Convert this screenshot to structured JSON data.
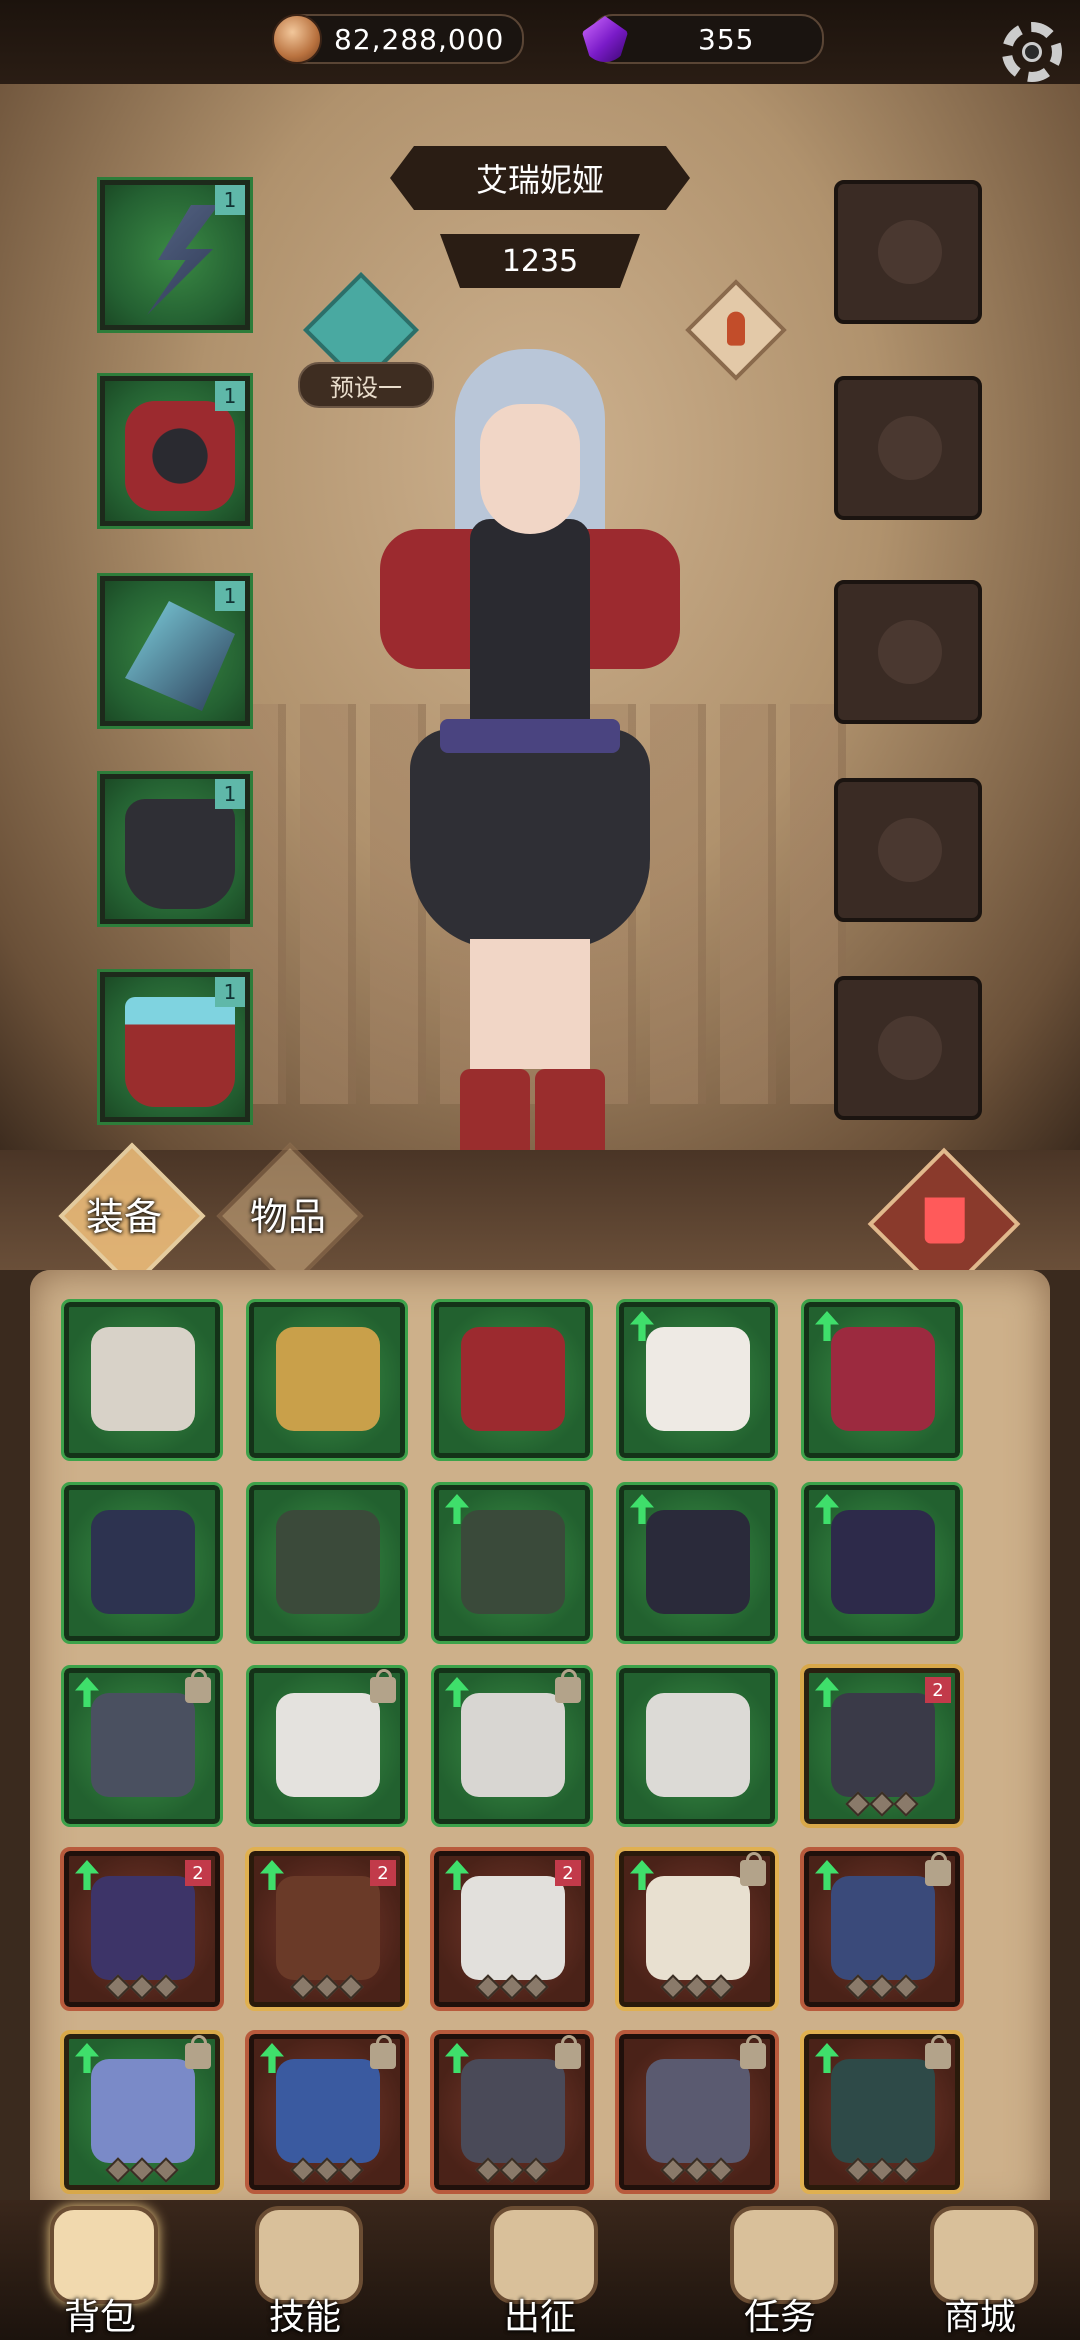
{
  "currency": {
    "coins": "82,288,000",
    "coin_icon": "coin-icon",
    "gems": "355",
    "gem_icon": "purple-gem-icon"
  },
  "settings_icon": "gear-icon",
  "character": {
    "name": "艾瑞妮娅",
    "power": "1235",
    "preset_label": "预设一"
  },
  "tabs": {
    "equipment": "装备",
    "items": "物品"
  },
  "equip_slots": [
    {
      "name": "weapon",
      "badge": "1"
    },
    {
      "name": "armor",
      "badge": "1"
    },
    {
      "name": "gloves",
      "badge": "1"
    },
    {
      "name": "pants",
      "badge": "1"
    },
    {
      "name": "boots",
      "badge": "1"
    }
  ],
  "inventory": [
    {
      "frame": "green",
      "up": false,
      "lock": false,
      "badge": "",
      "color": "#d8d2c8"
    },
    {
      "frame": "green",
      "up": false,
      "lock": false,
      "badge": "",
      "color": "#c9a04a"
    },
    {
      "frame": "green",
      "up": false,
      "lock": false,
      "badge": "",
      "color": "#9c2a2f"
    },
    {
      "frame": "green",
      "up": true,
      "lock": false,
      "badge": "",
      "color": "#eeeae4"
    },
    {
      "frame": "green",
      "up": true,
      "lock": false,
      "badge": "",
      "color": "#9c2a3f"
    },
    {
      "frame": "green",
      "up": false,
      "lock": false,
      "badge": "",
      "color": "#2d3350"
    },
    {
      "frame": "green",
      "up": false,
      "lock": false,
      "badge": "",
      "color": "#3b4a3a"
    },
    {
      "frame": "green",
      "up": true,
      "lock": false,
      "badge": "",
      "color": "#3a4a3a"
    },
    {
      "frame": "green",
      "up": true,
      "lock": false,
      "badge": "",
      "color": "#2a2a3a"
    },
    {
      "frame": "green",
      "up": true,
      "lock": false,
      "badge": "",
      "color": "#2d2a4a"
    },
    {
      "frame": "green",
      "up": true,
      "lock": true,
      "badge": "",
      "color": "#4a5060"
    },
    {
      "frame": "green",
      "up": false,
      "lock": true,
      "badge": "",
      "color": "#e4e2de"
    },
    {
      "frame": "green",
      "up": true,
      "lock": true,
      "badge": "",
      "color": "#d8d6d2"
    },
    {
      "frame": "green",
      "up": false,
      "lock": false,
      "badge": "",
      "color": "#dcdad6"
    },
    {
      "frame": "gold",
      "up": true,
      "lock": false,
      "badge": "2",
      "color": "#3a3a48"
    },
    {
      "frame": "red",
      "up": true,
      "lock": false,
      "badge": "2",
      "color": "#3d3468"
    },
    {
      "frame": "goldred",
      "up": true,
      "lock": false,
      "badge": "2",
      "color": "#6a3a28"
    },
    {
      "frame": "red",
      "up": true,
      "lock": false,
      "badge": "2",
      "color": "#e2e0dc"
    },
    {
      "frame": "goldred",
      "up": true,
      "lock": true,
      "badge": "",
      "color": "#e8e0d0"
    },
    {
      "frame": "red",
      "up": true,
      "lock": true,
      "badge": "",
      "color": "#3a4a7a"
    },
    {
      "frame": "gold",
      "up": true,
      "lock": true,
      "badge": "",
      "color": "#7a8ac8"
    },
    {
      "frame": "red",
      "up": true,
      "lock": true,
      "badge": "",
      "color": "#3a5aa0"
    },
    {
      "frame": "red",
      "up": true,
      "lock": true,
      "badge": "",
      "color": "#4a4a58"
    },
    {
      "frame": "red",
      "up": false,
      "lock": true,
      "badge": "",
      "color": "#5a5a70"
    },
    {
      "frame": "goldred",
      "up": true,
      "lock": true,
      "badge": "",
      "color": "#2e4a48"
    }
  ],
  "nav": [
    {
      "key": "bag",
      "label": "背包",
      "icon": "backpack-icon",
      "active": true
    },
    {
      "key": "skills",
      "label": "技能",
      "icon": "skill-book-icon",
      "active": false
    },
    {
      "key": "expedition",
      "label": "出征",
      "icon": "map-icon",
      "active": false
    },
    {
      "key": "quests",
      "label": "任务",
      "icon": "scroll-icon",
      "active": false
    },
    {
      "key": "shop",
      "label": "商城",
      "icon": "shop-crown-icon",
      "active": false
    }
  ]
}
